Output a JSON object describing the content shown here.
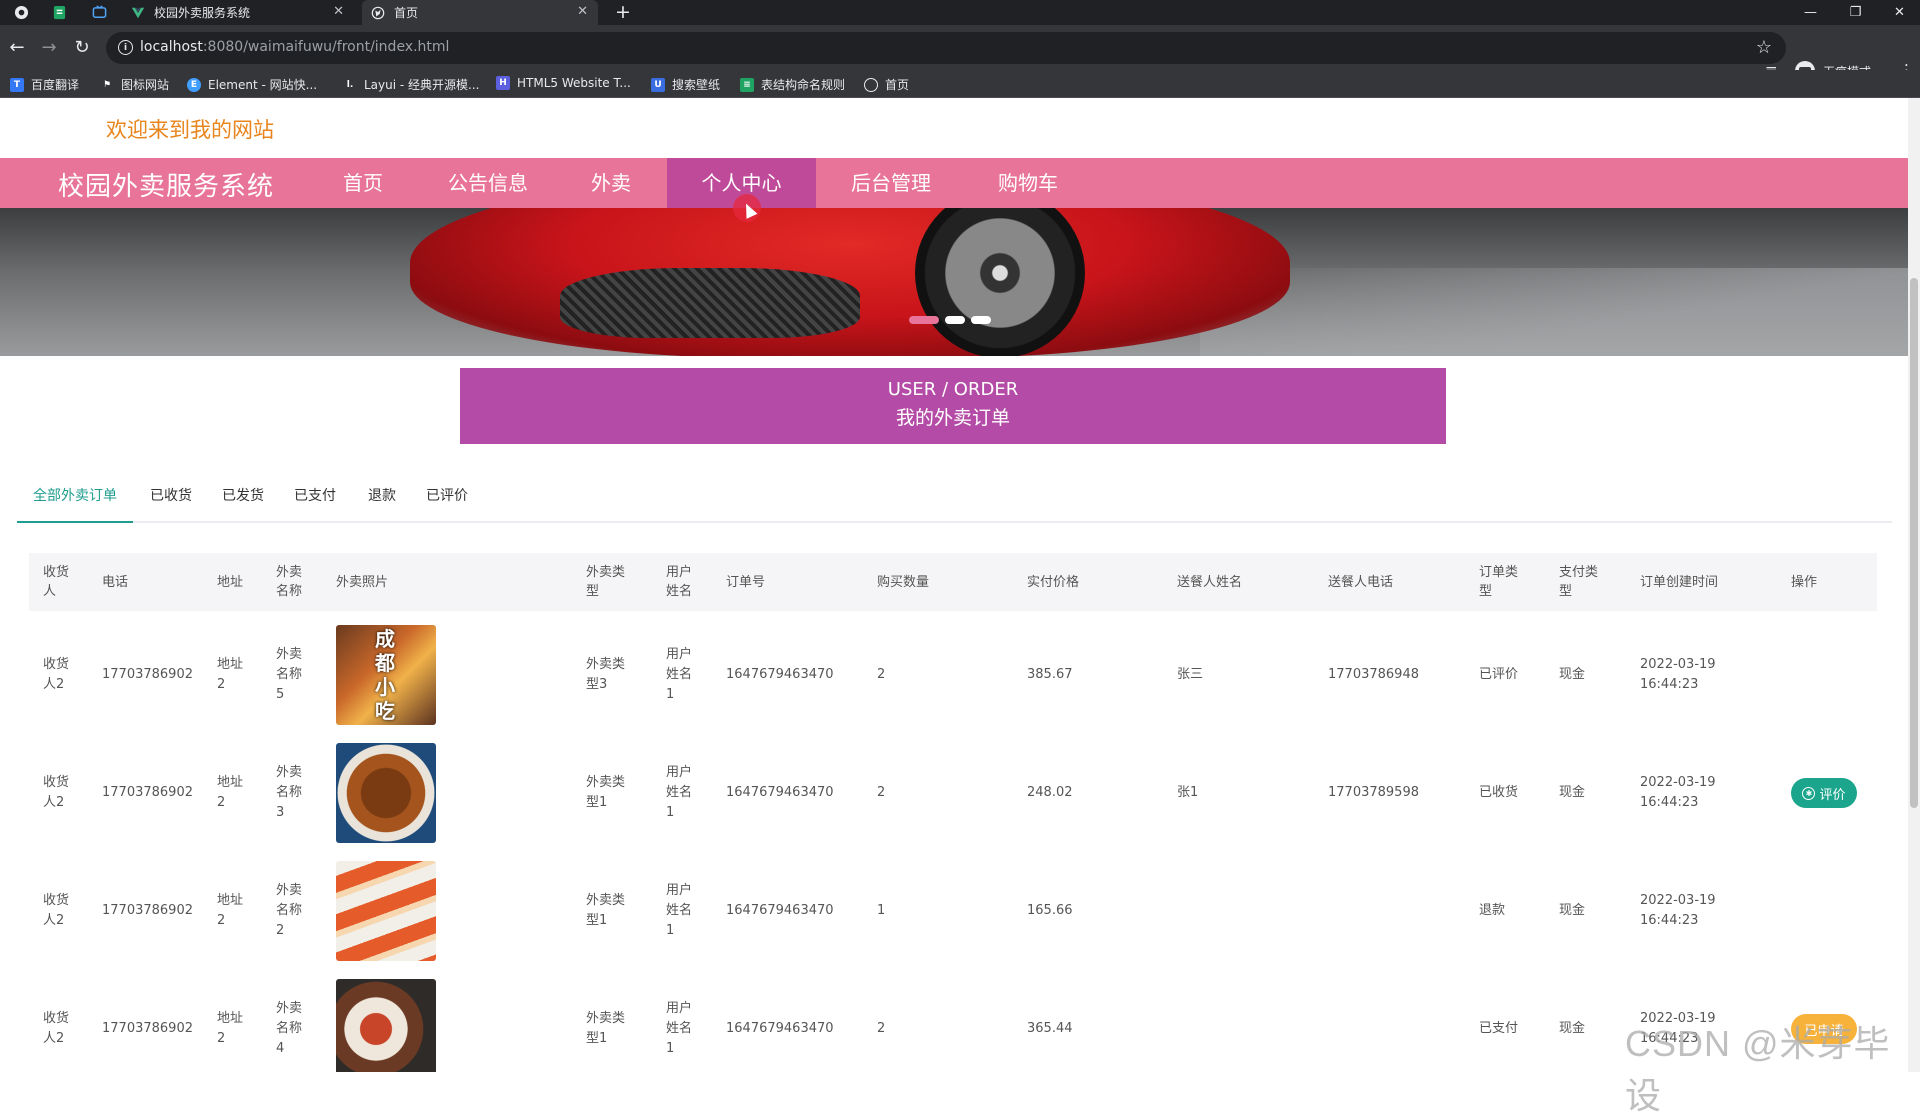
{
  "browser": {
    "tabs": [
      {
        "title": "校园外卖服务系统",
        "close": "✕"
      },
      {
        "title": "首页",
        "close": "✕"
      }
    ],
    "new_tab": "+",
    "url_host": "localhost",
    "url_path": ":8080/waimaifuwu/front/index.html",
    "incognito_label": "无痕模式",
    "bookmarks": [
      "百度翻译",
      "图标网站",
      "Element - 网站快...",
      "Layui - 经典开源模...",
      "HTML5 Website T...",
      "搜索壁纸",
      "表结构命名规则",
      "首页"
    ]
  },
  "site": {
    "welcome": "欢迎来到我的网站",
    "brand": "校园外卖服务系统",
    "nav": [
      "首页",
      "公告信息",
      "外卖",
      "个人中心",
      "后台管理",
      "购物车"
    ],
    "nav_active": "个人中心"
  },
  "order_header": {
    "en": "USER / ORDER",
    "zh": "我的外卖订单"
  },
  "subtabs": [
    "全部外卖订单",
    "已收货",
    "已发货",
    "已支付",
    "退款",
    "已评价"
  ],
  "table": {
    "columns": [
      "收货人",
      "电话",
      "地址",
      "外卖名称",
      "外卖照片",
      "外卖类型",
      "用户姓名",
      "订单号",
      "购买数量",
      "实付价格",
      "送餐人姓名",
      "送餐人电话",
      "订单类型",
      "支付类型",
      "订单创建时间",
      "操作"
    ],
    "rows": [
      {
        "receiver": "收货人2",
        "phone": "17703786902",
        "address": "地址2",
        "name": "外卖名称5",
        "type": "外卖类型3",
        "user": "用户姓名1",
        "order_no": "1647679463470",
        "qty": "2",
        "price": "385.67",
        "courier": "张三",
        "courier_phone": "17703786948",
        "status": "已评价",
        "pay": "现金",
        "created": "2022-03-19 16:44:23",
        "action": ""
      },
      {
        "receiver": "收货人2",
        "phone": "17703786902",
        "address": "地址2",
        "name": "外卖名称3",
        "type": "外卖类型1",
        "user": "用户姓名1",
        "order_no": "1647679463470",
        "qty": "2",
        "price": "248.02",
        "courier": "张1",
        "courier_phone": "17703789598",
        "status": "已收货",
        "pay": "现金",
        "created": "2022-03-19 16:44:23",
        "action": "评价"
      },
      {
        "receiver": "收货人2",
        "phone": "17703786902",
        "address": "地址2",
        "name": "外卖名称2",
        "type": "外卖类型1",
        "user": "用户姓名1",
        "order_no": "1647679463470",
        "qty": "1",
        "price": "165.66",
        "courier": "",
        "courier_phone": "",
        "status": "退款",
        "pay": "现金",
        "created": "2022-03-19 16:44:23",
        "action": ""
      },
      {
        "receiver": "收货人2",
        "phone": "17703786902",
        "address": "地址2",
        "name": "外卖名称4",
        "type": "外卖类型1",
        "user": "用户姓名1",
        "order_no": "1647679463470",
        "qty": "2",
        "price": "365.44",
        "courier": "",
        "courier_phone": "",
        "status": "已支付",
        "pay": "现金",
        "created": "2022-03-19 16:44:23",
        "action": "已申请"
      }
    ]
  },
  "photo_text": "成都小吃",
  "watermark": "CSDN @米芽毕设",
  "colors": {
    "nav_bg": "#e8749a",
    "nav_active": "#c04a9a",
    "order_head": "#b44ba6",
    "welcome": "#e8851d",
    "tab_active": "#1f9d8f",
    "btn_review": "#1ba58c"
  }
}
